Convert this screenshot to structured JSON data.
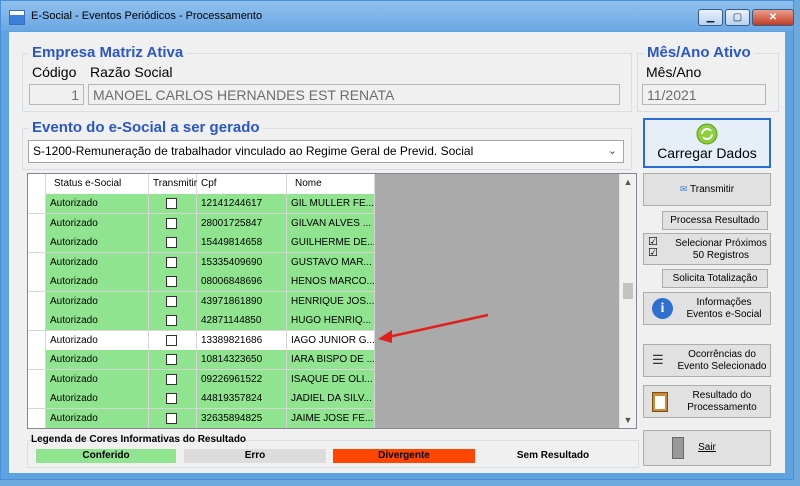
{
  "window": {
    "title": "E-Social - Eventos Periódicos - Processamento",
    "buttons": {
      "minimize": "▁",
      "maximize": "▢",
      "close": "✕"
    }
  },
  "empresa": {
    "group_title": "Empresa Matriz Ativa",
    "codigo_label": "Código",
    "razao_label": "Razão Social",
    "codigo_value": "1",
    "razao_value": "MANOEL CARLOS HERNANDES EST RENATA"
  },
  "periodo": {
    "group_title": "Mês/Ano Ativo",
    "label": "Mês/Ano",
    "value": "11/2021"
  },
  "evento": {
    "group_title": "Evento do e-Social a ser gerado",
    "selected": "S-1200-Remuneração de trabalhador vinculado ao Regime Geral de Previd. Social"
  },
  "grid": {
    "columns": [
      "Status e-Social",
      "Transmitir",
      "Cpf",
      "Nome"
    ],
    "rows": [
      {
        "status": "Autorizado",
        "cpf": "12141244617",
        "nome": "GIL MULLER FE...",
        "color": "#90e48f"
      },
      {
        "status": "Autorizado",
        "cpf": "28001725847",
        "nome": "GILVAN ALVES ...",
        "color": "#90e48f"
      },
      {
        "status": "Autorizado",
        "cpf": "15449814658",
        "nome": "GUILHERME DE...",
        "color": "#90e48f"
      },
      {
        "status": "Autorizado",
        "cpf": "15335409690",
        "nome": "GUSTAVO MAR...",
        "color": "#90e48f"
      },
      {
        "status": "Autorizado",
        "cpf": "08006848696",
        "nome": "HENOS MARCO...",
        "color": "#90e48f"
      },
      {
        "status": "Autorizado",
        "cpf": "43971861890",
        "nome": "HENRIQUE JOS...",
        "color": "#90e48f"
      },
      {
        "status": "Autorizado",
        "cpf": "42871144850",
        "nome": "HUGO HENRIQ...",
        "color": "#90e48f"
      },
      {
        "status": "Autorizado",
        "cpf": "13389821686",
        "nome": "IAGO JUNIOR G...",
        "color": "#ffffff"
      },
      {
        "status": "Autorizado",
        "cpf": "10814323650",
        "nome": "IARA BISPO DE ...",
        "color": "#90e48f"
      },
      {
        "status": "Autorizado",
        "cpf": "09226961522",
        "nome": "ISAQUE DE OLI...",
        "color": "#90e48f"
      },
      {
        "status": "Autorizado",
        "cpf": "44819357824",
        "nome": "JADIEL DA SILV...",
        "color": "#90e48f"
      },
      {
        "status": "Autorizado",
        "cpf": "32635894825",
        "nome": "JAIME JOSE FE...",
        "color": "#90e48f"
      },
      {
        "status": "",
        "cpf": "",
        "nome": "",
        "color": "#90e48f"
      }
    ]
  },
  "legend": {
    "title": "Legenda de Cores Informativas do Resultado",
    "items": [
      {
        "label": "Conferido",
        "color": "#90e48f"
      },
      {
        "label": "Erro",
        "color": "#dcdcdc"
      },
      {
        "label": "Divergente",
        "color": "#ff4500"
      },
      {
        "label": "Sem Resultado",
        "color": "#f0f0f0"
      }
    ]
  },
  "actions": {
    "carregar": "Carregar Dados",
    "transmitir": "Transmitir",
    "processa": "Processa Resultado",
    "selecionar": "Selecionar Próximos 50 Registros",
    "totalizacao": "Solicita Totalização",
    "informacoes": "Informações Eventos e-Social",
    "ocorrencias": "Ocorrências do Evento Selecionado",
    "resultado": "Resultado do Processamento",
    "sair": "Sair"
  },
  "colors": {
    "accent": "#2a57c8",
    "conferido": "#90e48f",
    "divergente": "#ff4500",
    "annotation_arrow": "#e0201b"
  }
}
